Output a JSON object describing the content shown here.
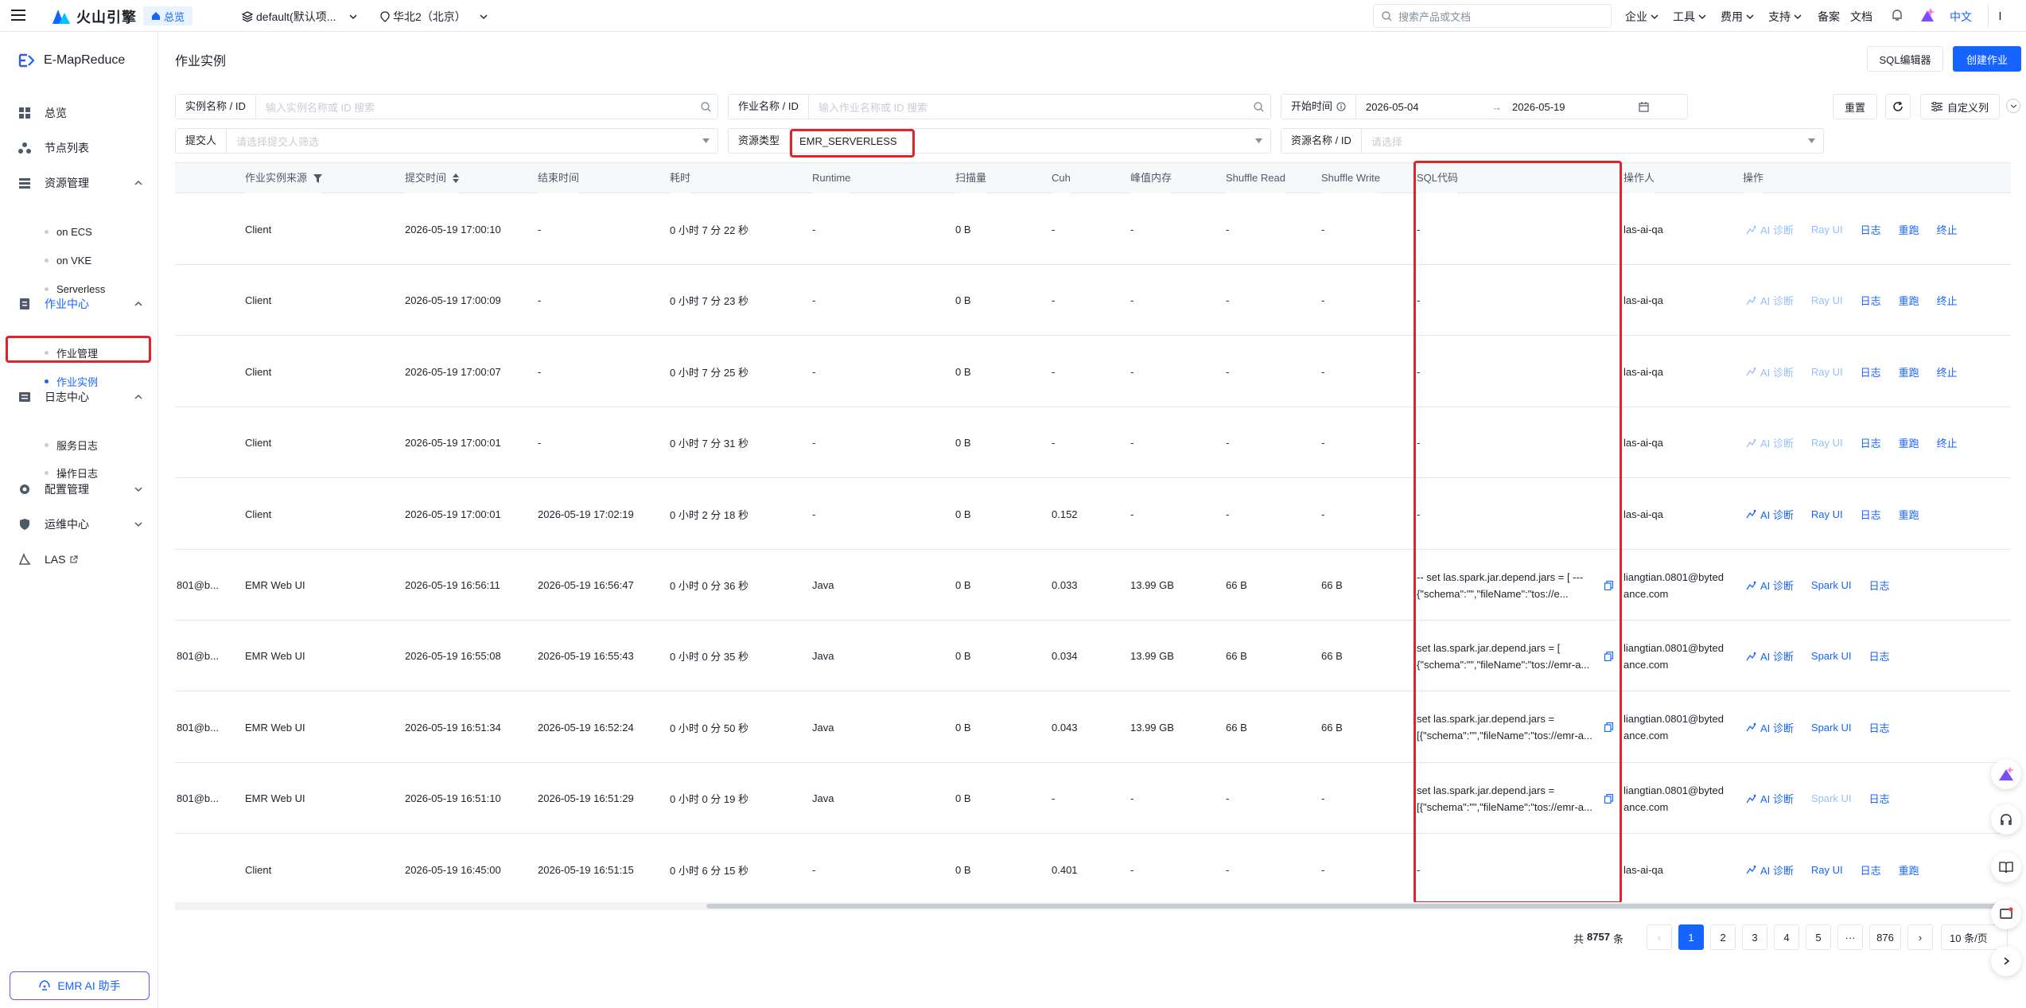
{
  "topbar": {
    "logo_text": "火山引擎",
    "home_tag": "总览",
    "project": "default(默认项...",
    "region": "华北2（北京）",
    "search_placeholder": "搜索产品或文档",
    "menu": [
      "企业",
      "工具",
      "费用",
      "支持",
      "备案",
      "文档"
    ],
    "language": "中文",
    "avatar_letter": "I"
  },
  "sidebar": {
    "product": "E-MapReduce",
    "items": [
      {
        "label": "总览",
        "icon": "grid-icon"
      },
      {
        "label": "节点列表",
        "icon": "nodes-icon"
      },
      {
        "label": "资源管理",
        "icon": "stack-icon",
        "expanded": true,
        "children": [
          "on ECS",
          "on VKE",
          "Serverless"
        ]
      },
      {
        "label": "作业中心",
        "icon": "job-icon",
        "expanded": true,
        "active": true,
        "children": [
          "作业管理",
          "作业实例"
        ]
      },
      {
        "label": "日志中心",
        "icon": "log-icon",
        "expanded": true,
        "children": [
          "服务日志",
          "操作日志"
        ]
      },
      {
        "label": "配置管理",
        "icon": "gear-icon",
        "expanded": false
      },
      {
        "label": "运维中心",
        "icon": "shield-icon",
        "expanded": false
      },
      {
        "label": "LAS",
        "icon": "las-icon",
        "external": true
      }
    ],
    "active_child": "作业实例",
    "assistant_button": "EMR AI 助手"
  },
  "page": {
    "title": "作业实例",
    "sql_editor_button": "SQL编辑器",
    "create_button": "创建作业"
  },
  "filters": {
    "instance_label": "实例名称 / ID",
    "instance_placeholder": "输入实例名称或 ID 搜索",
    "job_label": "作业名称 / ID",
    "job_placeholder": "输入作业名称或 ID 搜索",
    "start_label": "开始时间",
    "start_date": "2026-05-04",
    "end_date": "2026-05-19",
    "submitter_label": "提交人",
    "submitter_placeholder": "请选择提交人筛选",
    "resource_type_label": "资源类型",
    "resource_type_value": "EMR_SERVERLESS",
    "resource_name_label": "资源名称 / ID",
    "resource_name_placeholder": "请选择",
    "reset_button": "重置",
    "custom_columns_button": "自定义列"
  },
  "table": {
    "headers": [
      "作业实例来源",
      "提交时间",
      "结束时间",
      "耗时",
      "Runtime",
      "扫描量",
      "Cuh",
      "峰值内存",
      "Shuffle Read",
      "Shuffle Write",
      "SQL代码",
      "操作人",
      "操作"
    ],
    "rows": [
      {
        "id": "",
        "source": "Client",
        "submit": "2026-05-19 17:00:10",
        "end": "-",
        "duration": "0 小时 7 分 22 秒",
        "runtime": "-",
        "scan": "0 B",
        "cuh": "-",
        "mem": "-",
        "sread": "-",
        "swrite": "-",
        "sql": "-",
        "user": "las-ai-qa",
        "actions": [
          "AI 诊断",
          "Ray UI",
          "日志",
          "重跑",
          "终止"
        ],
        "disabled": [
          0,
          1
        ]
      },
      {
        "id": "",
        "source": "Client",
        "submit": "2026-05-19 17:00:09",
        "end": "-",
        "duration": "0 小时 7 分 23 秒",
        "runtime": "-",
        "scan": "0 B",
        "cuh": "-",
        "mem": "-",
        "sread": "-",
        "swrite": "-",
        "sql": "-",
        "user": "las-ai-qa",
        "actions": [
          "AI 诊断",
          "Ray UI",
          "日志",
          "重跑",
          "终止"
        ],
        "disabled": [
          0,
          1
        ]
      },
      {
        "id": "",
        "source": "Client",
        "submit": "2026-05-19 17:00:07",
        "end": "-",
        "duration": "0 小时 7 分 25 秒",
        "runtime": "-",
        "scan": "0 B",
        "cuh": "-",
        "mem": "-",
        "sread": "-",
        "swrite": "-",
        "sql": "-",
        "user": "las-ai-qa",
        "actions": [
          "AI 诊断",
          "Ray UI",
          "日志",
          "重跑",
          "终止"
        ],
        "disabled": [
          0,
          1
        ]
      },
      {
        "id": "",
        "source": "Client",
        "submit": "2026-05-19 17:00:01",
        "end": "-",
        "duration": "0 小时 7 分 31 秒",
        "runtime": "-",
        "scan": "0 B",
        "cuh": "-",
        "mem": "-",
        "sread": "-",
        "swrite": "-",
        "sql": "-",
        "user": "las-ai-qa",
        "actions": [
          "AI 诊断",
          "Ray UI",
          "日志",
          "重跑",
          "终止"
        ],
        "disabled": [
          0,
          1
        ]
      },
      {
        "id": "",
        "source": "Client",
        "submit": "2026-05-19 17:00:01",
        "end": "2026-05-19 17:02:19",
        "duration": "0 小时 2 分 18 秒",
        "runtime": "-",
        "scan": "0 B",
        "cuh": "0.152",
        "mem": "-",
        "sread": "-",
        "swrite": "-",
        "sql": "-",
        "user": "las-ai-qa",
        "actions": [
          "AI 诊断",
          "Ray UI",
          "日志",
          "重跑"
        ],
        "disabled": []
      },
      {
        "id": "801@b...",
        "source": "EMR Web UI",
        "submit": "2026-05-19 16:56:11",
        "end": "2026-05-19 16:56:47",
        "duration": "0 小时 0 分 36 秒",
        "runtime": "Java",
        "scan": "0 B",
        "cuh": "0.033",
        "mem": "13.99 GB",
        "sread": "66 B",
        "swrite": "66 B",
        "sql": "-- set las.spark.jar.depend.jars = [ --- {\"schema\":\"\",\"fileName\":\"tos://e...",
        "user": "liangtian.0801@bytedance.com",
        "actions": [
          "AI 诊断",
          "Spark UI",
          "日志"
        ],
        "disabled": []
      },
      {
        "id": "801@b...",
        "source": "EMR Web UI",
        "submit": "2026-05-19 16:55:08",
        "end": "2026-05-19 16:55:43",
        "duration": "0 小时 0 分 35 秒",
        "runtime": "Java",
        "scan": "0 B",
        "cuh": "0.034",
        "mem": "13.99 GB",
        "sread": "66 B",
        "swrite": "66 B",
        "sql": "set las.spark.jar.depend.jars = [ {\"schema\":\"\",\"fileName\":\"tos://emr-a...",
        "user": "liangtian.0801@bytedance.com",
        "actions": [
          "AI 诊断",
          "Spark UI",
          "日志"
        ],
        "disabled": []
      },
      {
        "id": "801@b...",
        "source": "EMR Web UI",
        "submit": "2026-05-19 16:51:34",
        "end": "2026-05-19 16:52:24",
        "duration": "0 小时 0 分 50 秒",
        "runtime": "Java",
        "scan": "0 B",
        "cuh": "0.043",
        "mem": "13.99 GB",
        "sread": "66 B",
        "swrite": "66 B",
        "sql": "set las.spark.jar.depend.jars = [{\"schema\":\"\",\"fileName\":\"tos://emr-a...",
        "user": "liangtian.0801@bytedance.com",
        "actions": [
          "AI 诊断",
          "Spark UI",
          "日志"
        ],
        "disabled": []
      },
      {
        "id": "801@b...",
        "source": "EMR Web UI",
        "submit": "2026-05-19 16:51:10",
        "end": "2026-05-19 16:51:29",
        "duration": "0 小时 0 分 19 秒",
        "runtime": "Java",
        "scan": "0 B",
        "cuh": "-",
        "mem": "-",
        "sread": "-",
        "swrite": "-",
        "sql": "set las.spark.jar.depend.jars = [{\"schema\":\"\",\"fileName\":\"tos://emr-a...",
        "user": "liangtian.0801@bytedance.com",
        "actions": [
          "AI 诊断",
          "Spark UI",
          "日志"
        ],
        "disabled": [
          1
        ]
      },
      {
        "id": "",
        "source": "Client",
        "submit": "2026-05-19 16:45:00",
        "end": "2026-05-19 16:51:15",
        "duration": "0 小时 6 分 15 秒",
        "runtime": "-",
        "scan": "0 B",
        "cuh": "0.401",
        "mem": "-",
        "sread": "-",
        "swrite": "-",
        "sql": "-",
        "user": "las-ai-qa",
        "actions": [
          "AI 诊断",
          "Ray UI",
          "日志",
          "重跑"
        ],
        "disabled": []
      }
    ]
  },
  "pagination": {
    "total_prefix": "共",
    "total": "8757",
    "total_suffix": "条",
    "pages": [
      "1",
      "2",
      "3",
      "4",
      "5",
      "···",
      "876"
    ],
    "current": "1",
    "page_size": "10 条/页"
  },
  "colors": {
    "accent": "#1664ff",
    "highlight": "#e0242b",
    "disabled_link": "#94bfff"
  }
}
